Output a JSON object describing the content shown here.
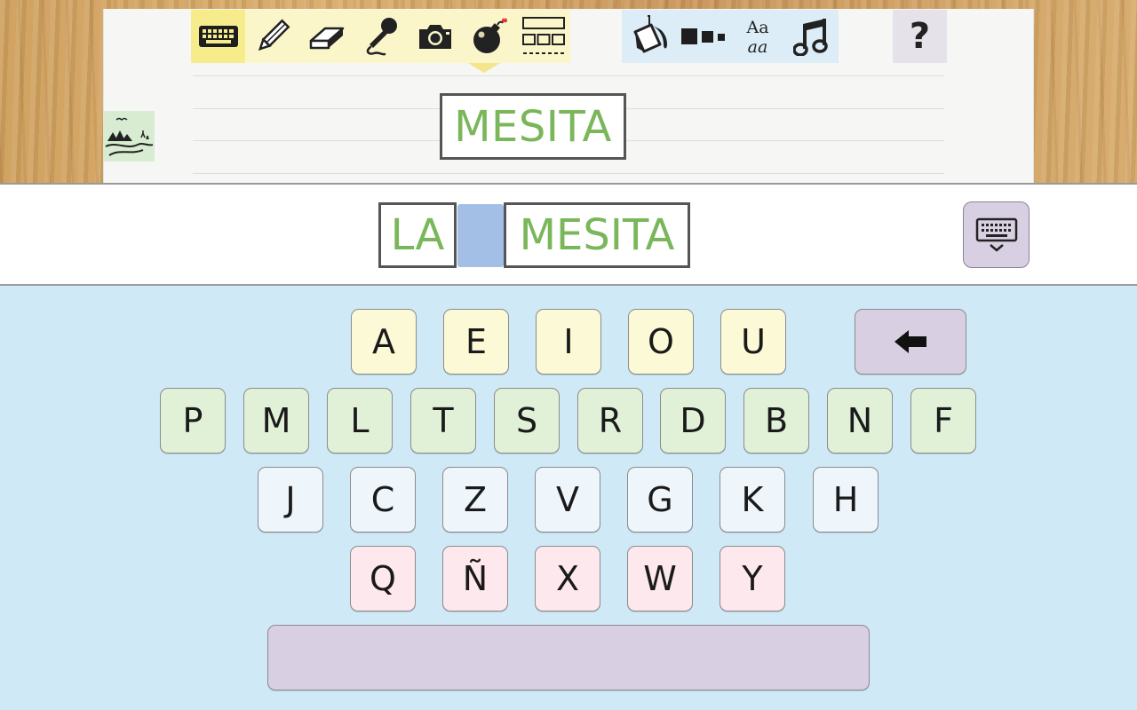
{
  "toolbar": {
    "left_tools": [
      {
        "name": "keyboard-icon",
        "active": true
      },
      {
        "name": "pencil-icon",
        "active": false
      },
      {
        "name": "eraser-icon",
        "active": false
      },
      {
        "name": "microphone-icon",
        "active": false
      },
      {
        "name": "camera-icon",
        "active": false
      },
      {
        "name": "bomb-icon",
        "active": false
      },
      {
        "name": "layout-icon",
        "active": false
      }
    ],
    "right_tools": [
      {
        "name": "paint-bucket-icon"
      },
      {
        "name": "size-squares-icon"
      },
      {
        "name": "font-style-icon",
        "text_top": "Aa",
        "text_bottom": "aa"
      },
      {
        "name": "music-note-icon"
      }
    ],
    "help_label": "?"
  },
  "canvas": {
    "word_card": "MESITA",
    "scene_icon": "landscape-icon"
  },
  "composition": {
    "words": [
      "LA",
      "MESITA"
    ],
    "toggle_icon": "hide-keyboard-icon"
  },
  "keyboard": {
    "row1": [
      "A",
      "E",
      "I",
      "O",
      "U"
    ],
    "row2": [
      "P",
      "M",
      "L",
      "T",
      "S",
      "R",
      "D",
      "B",
      "N",
      "F"
    ],
    "row3": [
      "J",
      "C",
      "Z",
      "V",
      "G",
      "K",
      "H"
    ],
    "row4": [
      "Q",
      "Ñ",
      "X",
      "W",
      "Y"
    ],
    "backspace_icon": "backspace-arrow-icon"
  },
  "colors": {
    "word_green": "#7ab65a",
    "vowel_key": "#fcfad6",
    "consonant_key": "#e0f1d8",
    "pale_key": "#eef5fb",
    "pink_key": "#fde8ee",
    "lilac": "#d8d0e2",
    "keyboard_bg": "#cfe9f6"
  }
}
